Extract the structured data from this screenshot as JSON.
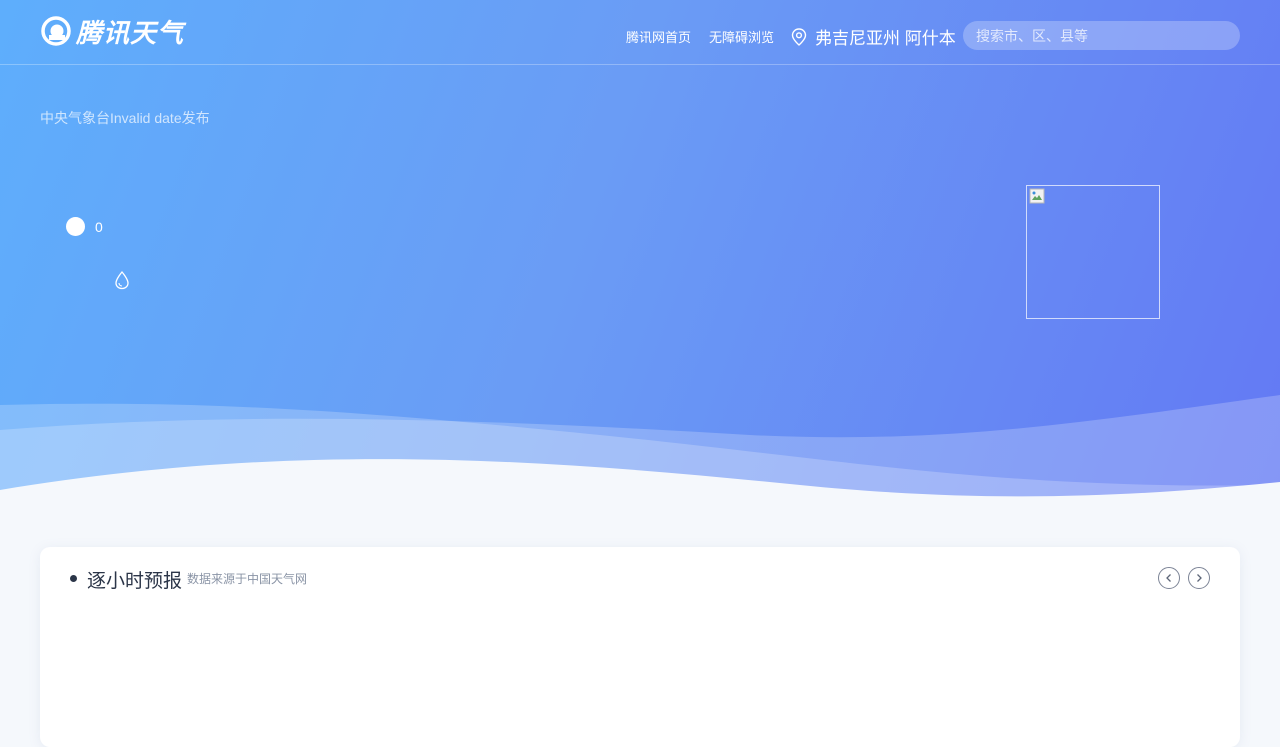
{
  "header": {
    "logo_text": "腾讯天气",
    "nav": {
      "home": "腾讯网首页",
      "accessibility": "无障碍浏览"
    },
    "location": "弗吉尼亚州 阿什本",
    "search": {
      "placeholder": "搜索市、区、县等",
      "value": ""
    }
  },
  "current": {
    "publish_text": "中央气象台Invalid date发布",
    "temperature": "0"
  },
  "hourly": {
    "title": "逐小时预报",
    "source": "数据来源于中国天气网"
  },
  "colors": {
    "hero_start": "#5eaefc",
    "hero_end": "#6379f4",
    "page_bg": "#f5f8fc",
    "title_text": "#2b3548"
  },
  "icons": [
    "logo-icon",
    "location-pin-icon",
    "sun-dot-icon",
    "water-drop-icon",
    "broken-image-icon",
    "chevron-left-icon",
    "chevron-right-icon"
  ]
}
